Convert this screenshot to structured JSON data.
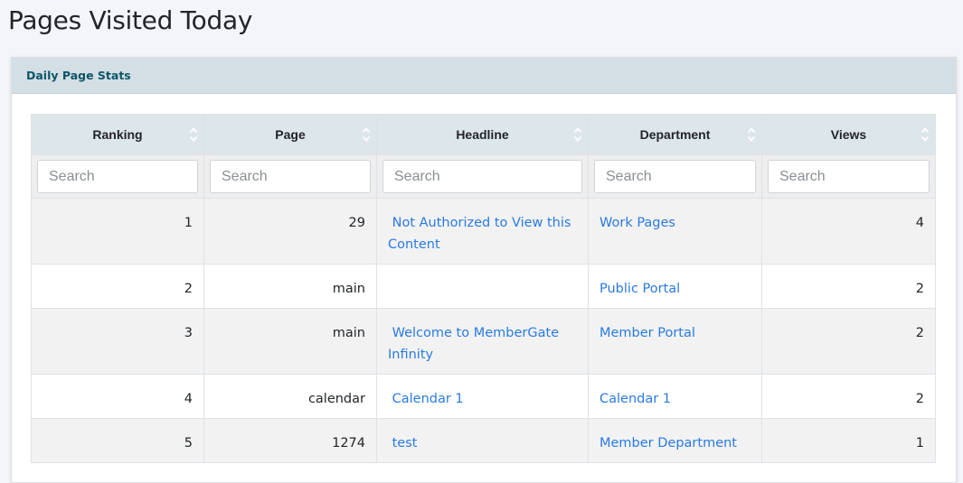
{
  "page": {
    "title": "Pages Visited Today"
  },
  "card": {
    "title": "Daily Page Stats"
  },
  "table": {
    "columns": [
      {
        "label": "Ranking",
        "search_placeholder": "Search"
      },
      {
        "label": "Page",
        "search_placeholder": "Search"
      },
      {
        "label": "Headline",
        "search_placeholder": "Search"
      },
      {
        "label": "Department",
        "search_placeholder": "Search"
      },
      {
        "label": "Views",
        "search_placeholder": "Search"
      }
    ],
    "sort_icon": "sort-both-icon",
    "rows": [
      {
        "ranking": "1",
        "page": "29",
        "headline": " Not Authorized to View this Content",
        "department": "Work Pages",
        "views": "4"
      },
      {
        "ranking": "2",
        "page": "main",
        "headline": "",
        "department": "Public Portal",
        "views": "2"
      },
      {
        "ranking": "3",
        "page": "main",
        "headline": " Welcome to MemberGate Infinity",
        "department": "Member Portal",
        "views": "2"
      },
      {
        "ranking": "4",
        "page": "calendar",
        "headline": " Calendar 1",
        "department": "Calendar 1",
        "views": "2"
      },
      {
        "ranking": "5",
        "page": "1274",
        "headline": " test",
        "department": "Member Department",
        "views": "1"
      }
    ]
  },
  "colors": {
    "link": "#2a7ae2",
    "header_bg": "#d3dfe5",
    "card_title": "#0f5566",
    "th_bg": "#dde6eb"
  }
}
